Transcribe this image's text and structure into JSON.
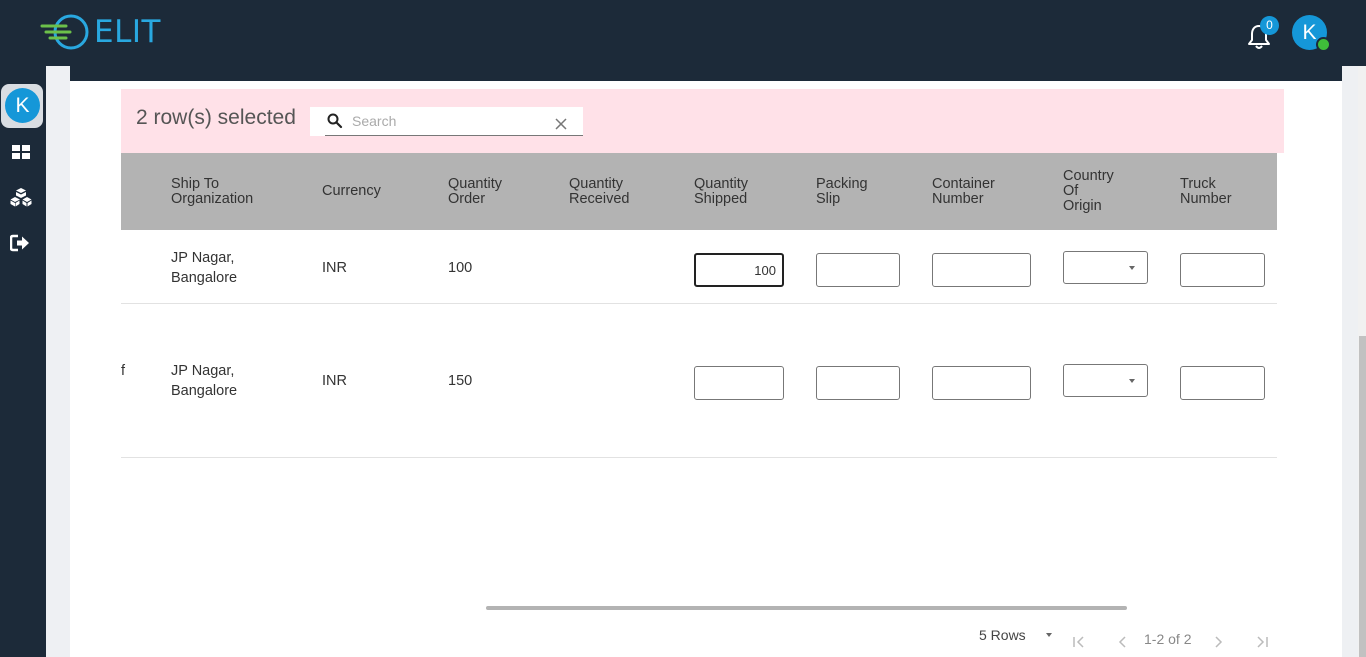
{
  "header": {
    "app_name": "ELIT",
    "notification_count": "0",
    "user_initial": "K"
  },
  "sidebar": {
    "user_initial": "K",
    "items": [
      {
        "icon": "dashboard-icon"
      },
      {
        "icon": "cubes-icon"
      },
      {
        "icon": "logout-icon"
      }
    ]
  },
  "selection": {
    "label": "2 row(s) selected",
    "search_placeholder": "Search"
  },
  "table": {
    "columns": [
      {
        "lines": [
          "Ship To",
          "Organization"
        ]
      },
      {
        "lines": [
          "Currency"
        ]
      },
      {
        "lines": [
          "Quantity",
          "Order"
        ]
      },
      {
        "lines": [
          "Quantity",
          "Received"
        ]
      },
      {
        "lines": [
          "Quantity",
          "Shipped"
        ]
      },
      {
        "lines": [
          "Packing",
          "Slip"
        ]
      },
      {
        "lines": [
          "Container",
          "Number"
        ]
      },
      {
        "lines": [
          "Country",
          "Of",
          "Origin"
        ]
      },
      {
        "lines": [
          "Truck",
          "Number"
        ]
      }
    ],
    "rows": [
      {
        "lead": "",
        "ship_to": [
          "JP Nagar,",
          "Bangalore"
        ],
        "currency": "INR",
        "quantity_order": "100",
        "quantity_received": "",
        "quantity_shipped": "100",
        "packing_slip": "",
        "container_number": "",
        "country_of_origin": "",
        "truck_number": ""
      },
      {
        "lead": "f",
        "ship_to": [
          "JP Nagar,",
          "Bangalore"
        ],
        "currency": "INR",
        "quantity_order": "150",
        "quantity_received": "",
        "quantity_shipped": "",
        "packing_slip": "",
        "container_number": "",
        "country_of_origin": "",
        "truck_number": ""
      }
    ]
  },
  "pagination": {
    "rows_per_page": "5 Rows",
    "range": "1-2 of 2"
  }
}
